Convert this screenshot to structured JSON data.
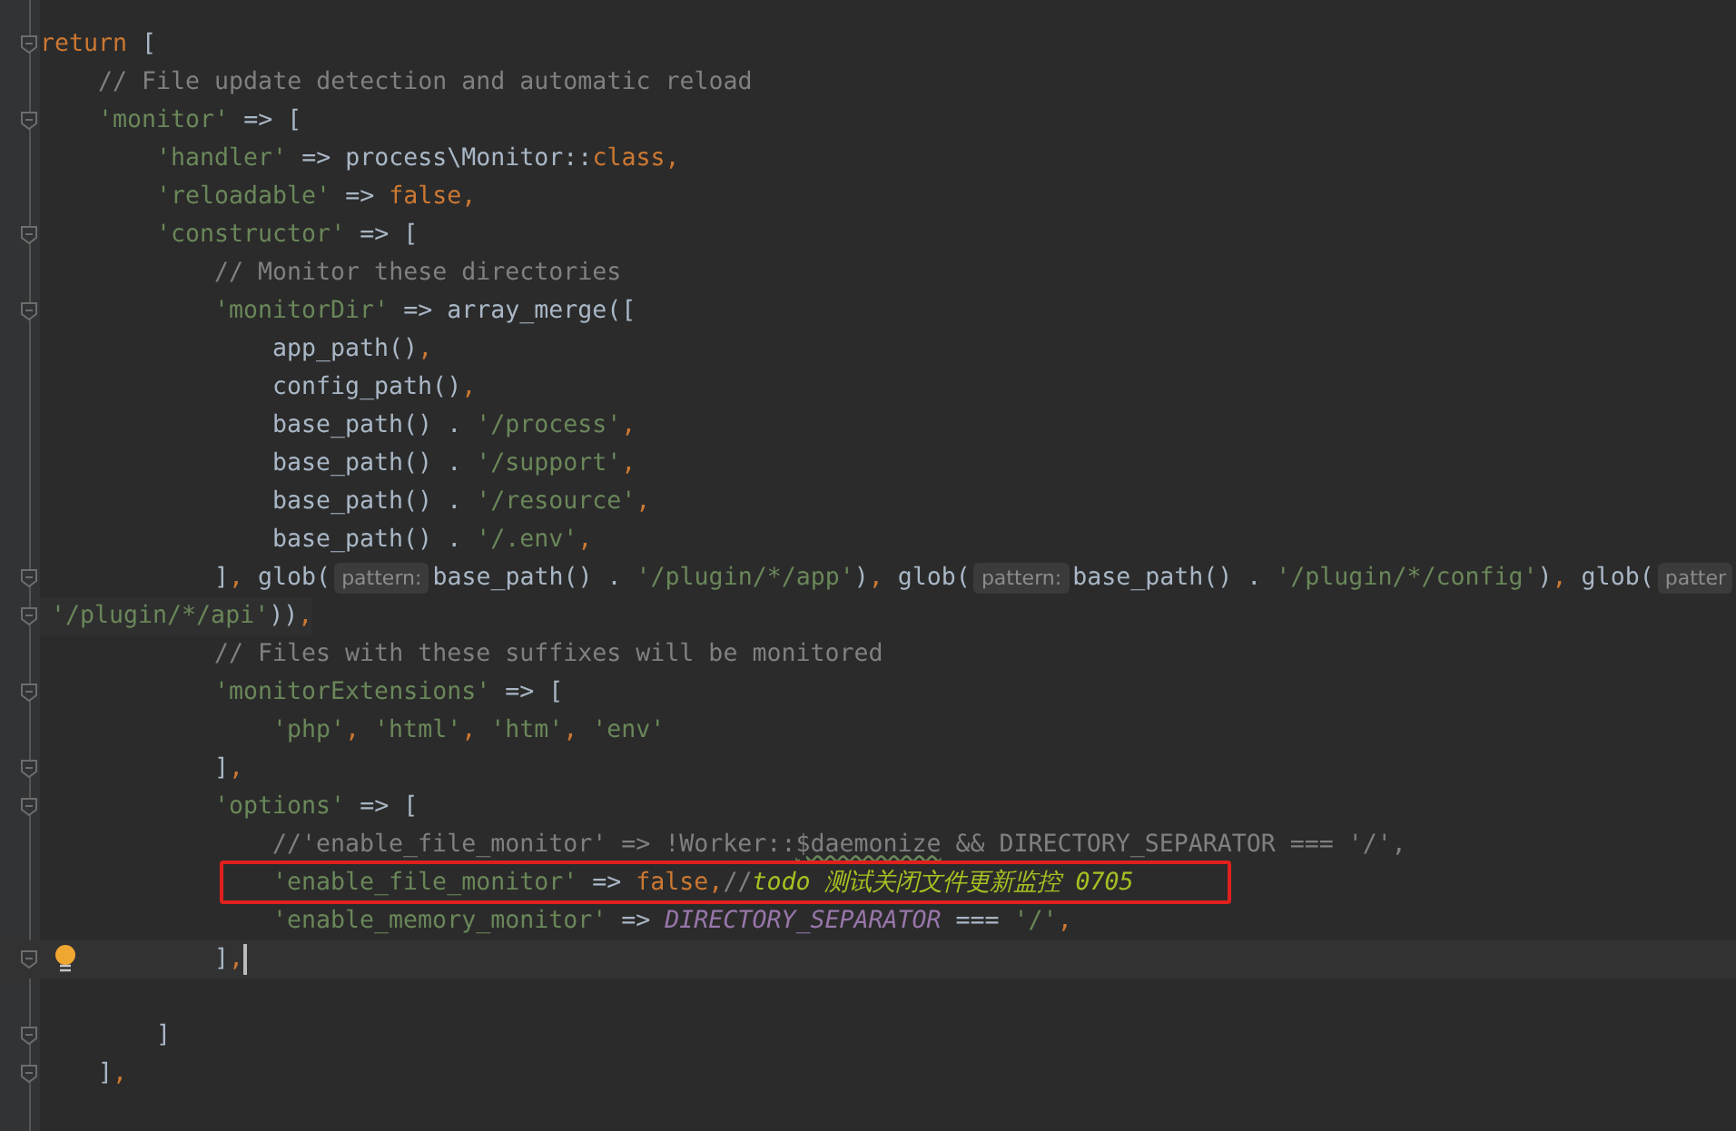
{
  "editor": {
    "lines": [
      {
        "kind": "code",
        "fold": true,
        "current": false,
        "tokens": [
          {
            "kind": "keyword",
            "text": "return"
          },
          {
            "kind": "plain",
            "text": " ["
          }
        ],
        "children": [
          {
            "kind": "code",
            "fold": false,
            "current": false,
            "tokens": [
              {
                "kind": "comment",
                "text": "// File update detection and automatic reload"
              }
            ]
          },
          {
            "kind": "code",
            "fold": true,
            "current": false,
            "tokens": [
              {
                "kind": "string",
                "text": "'monitor'"
              },
              {
                "kind": "plain",
                "text": " => ["
              }
            ],
            "children": [
              {
                "kind": "code",
                "fold": false,
                "current": false,
                "tokens": [
                  {
                    "kind": "string",
                    "text": "'handler'"
                  },
                  {
                    "kind": "plain",
                    "text": " => process\\Monitor::"
                  },
                  {
                    "kind": "keyword",
                    "text": "class,"
                  }
                ]
              },
              {
                "kind": "code",
                "fold": false,
                "current": false,
                "tokens": [
                  {
                    "kind": "string",
                    "text": "'reloadable'"
                  },
                  {
                    "kind": "plain",
                    "text": " => "
                  },
                  {
                    "kind": "keyword",
                    "text": "false,"
                  }
                ]
              },
              {
                "kind": "code",
                "fold": true,
                "current": false,
                "tokens": [
                  {
                    "kind": "string",
                    "text": "'constructor'"
                  },
                  {
                    "kind": "plain",
                    "text": " => ["
                  }
                ],
                "children": [
                  {
                    "kind": "code",
                    "fold": false,
                    "current": false,
                    "tokens": [
                      {
                        "kind": "comment",
                        "text": "// Monitor these directories"
                      }
                    ]
                  },
                  {
                    "kind": "code",
                    "fold": true,
                    "current": false,
                    "tokens": [
                      {
                        "kind": "string",
                        "text": "'monitorDir'"
                      },
                      {
                        "kind": "plain",
                        "text": " => array_merge(["
                      }
                    ],
                    "children": [
                      {
                        "kind": "code",
                        "fold": false,
                        "current": false,
                        "tokens": [
                          {
                            "kind": "plain",
                            "text": "app_path()"
                          },
                          {
                            "kind": "keyword",
                            "text": ","
                          }
                        ]
                      },
                      {
                        "kind": "code",
                        "fold": false,
                        "current": false,
                        "tokens": [
                          {
                            "kind": "plain",
                            "text": "config_path()"
                          },
                          {
                            "kind": "keyword",
                            "text": ","
                          }
                        ]
                      },
                      {
                        "kind": "code",
                        "fold": false,
                        "current": false,
                        "tokens": [
                          {
                            "kind": "plain",
                            "text": "base_path() . "
                          },
                          {
                            "kind": "string",
                            "text": "'/process'"
                          },
                          {
                            "kind": "keyword",
                            "text": ","
                          }
                        ]
                      },
                      {
                        "kind": "code",
                        "fold": false,
                        "current": false,
                        "tokens": [
                          {
                            "kind": "plain",
                            "text": "base_path() . "
                          },
                          {
                            "kind": "string",
                            "text": "'/support'"
                          },
                          {
                            "kind": "keyword",
                            "text": ","
                          }
                        ]
                      },
                      {
                        "kind": "code",
                        "fold": false,
                        "current": false,
                        "tokens": [
                          {
                            "kind": "plain",
                            "text": "base_path() . "
                          },
                          {
                            "kind": "string",
                            "text": "'/resource'"
                          },
                          {
                            "kind": "keyword",
                            "text": ","
                          }
                        ]
                      },
                      {
                        "kind": "code",
                        "fold": false,
                        "current": false,
                        "tokens": [
                          {
                            "kind": "plain",
                            "text": "base_path() . "
                          },
                          {
                            "kind": "string",
                            "text": "'/.env'"
                          },
                          {
                            "kind": "keyword",
                            "text": ","
                          }
                        ]
                      }
                    ]
                  },
                  {
                    "kind": "code",
                    "fold": true,
                    "current": false,
                    "tokens": [
                      {
                        "kind": "plain",
                        "text": "]"
                      },
                      {
                        "kind": "keyword",
                        "text": ","
                      },
                      {
                        "kind": "plain",
                        "text": " glob("
                      },
                      {
                        "kind": "hint",
                        "text": "pattern:"
                      },
                      {
                        "kind": "plain",
                        "text": "base_path() . "
                      },
                      {
                        "kind": "string",
                        "text": "'/plugin/*/app'"
                      },
                      {
                        "kind": "plain",
                        "text": ")"
                      },
                      {
                        "kind": "keyword",
                        "text": ","
                      },
                      {
                        "kind": "plain",
                        "text": " glob("
                      },
                      {
                        "kind": "hint",
                        "text": "pattern:"
                      },
                      {
                        "kind": "plain",
                        "text": "base_path() . "
                      },
                      {
                        "kind": "string",
                        "text": "'/plugin/*/config'"
                      },
                      {
                        "kind": "plain",
                        "text": ")"
                      },
                      {
                        "kind": "keyword",
                        "text": ","
                      },
                      {
                        "kind": "plain",
                        "text": " glob("
                      },
                      {
                        "kind": "hint",
                        "text": "patter"
                      }
                    ]
                  },
                  {
                    "kind": "wrap",
                    "fold": true,
                    "current": false,
                    "tokens": [
                      {
                        "kind": "string",
                        "text": "'/plugin/*/api'"
                      },
                      {
                        "kind": "plain",
                        "text": "))"
                      },
                      {
                        "kind": "keyword",
                        "text": ","
                      }
                    ]
                  },
                  {
                    "kind": "code",
                    "fold": false,
                    "current": false,
                    "tokens": [
                      {
                        "kind": "comment",
                        "text": "// Files with these suffixes will be monitored"
                      }
                    ]
                  },
                  {
                    "kind": "code",
                    "fold": true,
                    "current": false,
                    "tokens": [
                      {
                        "kind": "string",
                        "text": "'monitorExtensions'"
                      },
                      {
                        "kind": "plain",
                        "text": " => ["
                      }
                    ],
                    "children": [
                      {
                        "kind": "code",
                        "fold": false,
                        "current": false,
                        "tokens": [
                          {
                            "kind": "string",
                            "text": "'php'"
                          },
                          {
                            "kind": "keyword",
                            "text": ", "
                          },
                          {
                            "kind": "string",
                            "text": "'html'"
                          },
                          {
                            "kind": "keyword",
                            "text": ", "
                          },
                          {
                            "kind": "string",
                            "text": "'htm'"
                          },
                          {
                            "kind": "keyword",
                            "text": ", "
                          },
                          {
                            "kind": "string",
                            "text": "'env'"
                          }
                        ]
                      }
                    ]
                  },
                  {
                    "kind": "code",
                    "fold": true,
                    "current": false,
                    "tokens": [
                      {
                        "kind": "plain",
                        "text": "]"
                      },
                      {
                        "kind": "keyword",
                        "text": ","
                      }
                    ]
                  },
                  {
                    "kind": "code",
                    "fold": true,
                    "current": false,
                    "tokens": [
                      {
                        "kind": "string",
                        "text": "'options'"
                      },
                      {
                        "kind": "plain",
                        "text": " => ["
                      }
                    ],
                    "children": [
                      {
                        "kind": "code",
                        "fold": false,
                        "current": false,
                        "tokens": [
                          {
                            "kind": "comment",
                            "text": "//'enable_file_monitor' => !Worker::"
                          },
                          {
                            "kind": "typo",
                            "text": "$daemonize"
                          },
                          {
                            "kind": "comment",
                            "text": " && DIRECTORY_SEPARATOR === '/',"
                          }
                        ]
                      },
                      {
                        "kind": "code",
                        "fold": false,
                        "current": false,
                        "tokens": [
                          {
                            "kind": "string",
                            "text": "'enable_file_monitor'"
                          },
                          {
                            "kind": "plain",
                            "text": " => "
                          },
                          {
                            "kind": "keyword",
                            "text": "false,"
                          },
                          {
                            "kind": "comment",
                            "text": "//"
                          },
                          {
                            "kind": "todo",
                            "text": "todo 测试关闭文件更新监控 0705"
                          }
                        ]
                      },
                      {
                        "kind": "code",
                        "fold": false,
                        "current": false,
                        "tokens": [
                          {
                            "kind": "string",
                            "text": "'enable_memory_monitor'"
                          },
                          {
                            "kind": "plain",
                            "text": " => "
                          },
                          {
                            "kind": "constant",
                            "text": "DIRECTORY_SEPARATOR"
                          },
                          {
                            "kind": "plain",
                            "text": " === "
                          },
                          {
                            "kind": "string",
                            "text": "'/'"
                          },
                          {
                            "kind": "keyword",
                            "text": ","
                          }
                        ]
                      }
                    ]
                  },
                  {
                    "kind": "code",
                    "fold": true,
                    "current": true,
                    "tokens": [
                      {
                        "kind": "plain",
                        "text": "]"
                      },
                      {
                        "kind": "keyword",
                        "text": ","
                      }
                    ]
                  }
                ]
              },
              {
                "kind": "blank",
                "fold": false,
                "current": false
              },
              {
                "kind": "code",
                "fold": true,
                "current": false,
                "tokens": [
                  {
                    "kind": "plain",
                    "text": "]"
                  }
                ]
              }
            ]
          },
          {
            "kind": "code",
            "fold": true,
            "current": false,
            "tokens": [
              {
                "kind": "plain",
                "text": "]"
              },
              {
                "kind": "keyword",
                "text": ","
              }
            ]
          }
        ]
      }
    ]
  }
}
